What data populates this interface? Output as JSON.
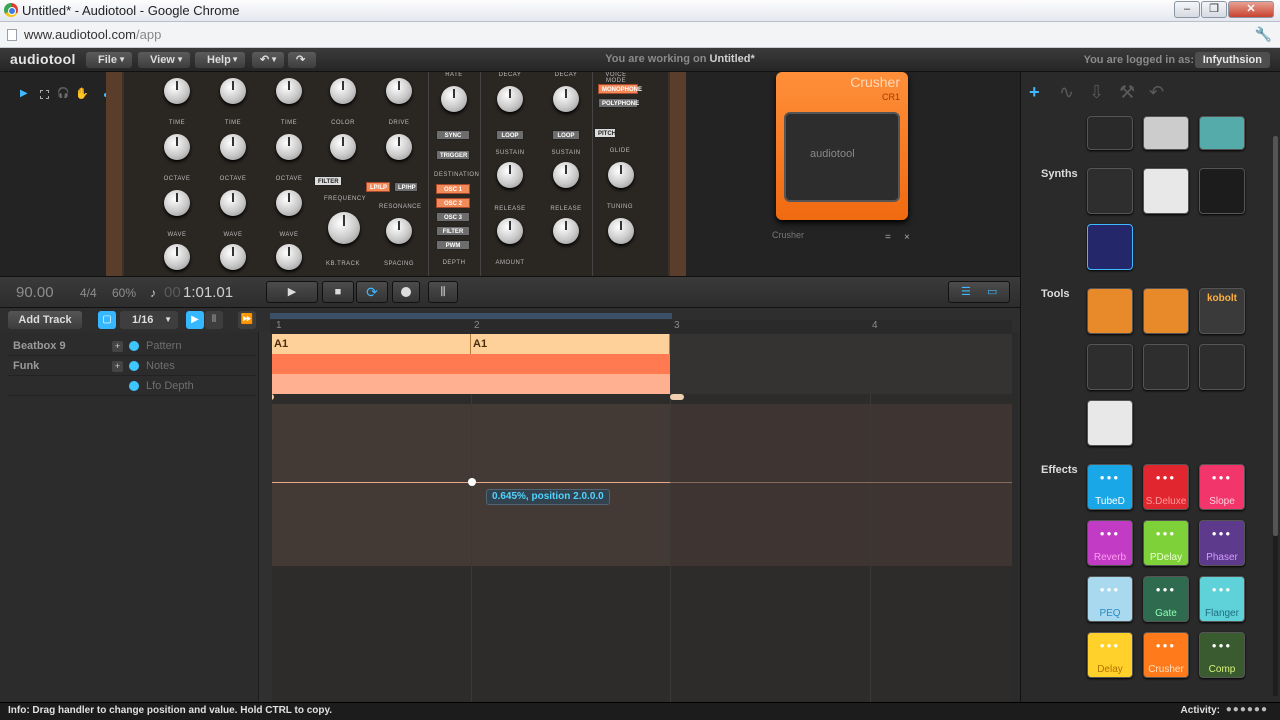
{
  "window": {
    "title": "Untitled* - Audiotool - Google Chrome"
  },
  "address": {
    "url_host": "www.audiotool.com",
    "url_path": "/app"
  },
  "menubar": {
    "logo": "audiotool",
    "menus": [
      "File",
      "View",
      "Help"
    ],
    "working_prefix": "You are working on",
    "project_name": "Untitled*",
    "logged_in_label": "You are logged in as:",
    "username": "Infyuthsion"
  },
  "synth": {
    "osc_labels": [
      "TIME",
      "TIME",
      "TIME",
      "OCTAVE",
      "OCTAVE",
      "OCTAVE",
      "WAVE",
      "WAVE",
      "WAVE"
    ],
    "color_label": "COLOR",
    "drive_label": "DRIVE",
    "filter_btn": "FILTER",
    "lplp_btn": "LP/LP",
    "lphp_btn": "LP/HP",
    "frequency_label": "FREQUENCY",
    "resonance_label": "RESONANCE",
    "kbtrack_label": "KB.TRACK",
    "spacing_label": "SPACING",
    "rate_label": "RATE",
    "sync_btn": "SYNC",
    "trigger_btn": "TRIGGER",
    "destination_label": "DESTINATION",
    "dest_buttons": [
      "OSC 1",
      "OSC 2",
      "OSC 3",
      "FILTER",
      "PWM"
    ],
    "depth_label": "DEPTH",
    "decay_label": "DECAY",
    "loop_btn": "LOOP",
    "sustain_label": "SUSTAIN",
    "release_label": "RELEASE",
    "amount_label": "AMOUNT",
    "voice_mode_label": "VOICE MODE",
    "monophone_btn": "MONOPHONE",
    "polyphone_btn": "POLYPHONE",
    "pitch_btn": "PITCH",
    "glide_label": "GLIDE",
    "tuning_label": "TUNING"
  },
  "pedal": {
    "name": "Crusher",
    "model": "CR1",
    "brand": "audiotool",
    "device_label": "Crusher",
    "menu_icon": "=",
    "close_icon": "×"
  },
  "transport": {
    "bpm": "90.00",
    "signature": "4/4",
    "zoom": "60%",
    "position_dim": "00",
    "position": "1:01.01"
  },
  "sequencer": {
    "add_track": "Add Track",
    "snap": "1/16",
    "ruler": [
      "1",
      "2",
      "3",
      "4"
    ],
    "tracks": [
      {
        "name": "Beatbox 9",
        "sub": "Pattern"
      },
      {
        "name": "Funk",
        "sub": "Notes"
      },
      {
        "name": "",
        "sub": "Lfo Depth"
      }
    ],
    "regions": [
      "A1",
      "A1"
    ],
    "tooltip": "0.645%, position 2.0.0.0"
  },
  "sidebar": {
    "sections": {
      "synths": "Synths",
      "tools": "Tools",
      "effects": "Effects"
    },
    "tools": [
      "kobolt"
    ],
    "effects": [
      {
        "name": "TubeD",
        "bg": "#1aa7e8",
        "color": "#ffffff"
      },
      {
        "name": "S.Deluxe",
        "bg": "#e2262f",
        "color": "#ff9a9a"
      },
      {
        "name": "Slope",
        "bg": "#f2356b",
        "color": "#ffd0dc"
      },
      {
        "name": "Reverb",
        "bg": "#c23bc4",
        "color": "#ff9cf5"
      },
      {
        "name": "PDelay",
        "bg": "#7fd13a",
        "color": "#e9ffd0"
      },
      {
        "name": "Phaser",
        "bg": "#5e3a8c",
        "color": "#d49cff"
      },
      {
        "name": "PEQ",
        "bg": "#a9d9ef",
        "color": "#2b8cc2"
      },
      {
        "name": "Gate",
        "bg": "#2f6b4f",
        "color": "#8effb8"
      },
      {
        "name": "Flanger",
        "bg": "#5fd1d8",
        "color": "#1f6e80"
      },
      {
        "name": "Delay",
        "bg": "#ffd12a",
        "color": "#b47200"
      },
      {
        "name": "Crusher",
        "bg": "#ff7a1a",
        "color": "#ffe0c0"
      },
      {
        "name": "Comp",
        "bg": "#3a5b2f",
        "color": "#d9f27a"
      }
    ]
  },
  "status": {
    "info": "Info: Drag handler to change position and value. Hold CTRL to copy.",
    "activity_label": "Activity:"
  }
}
